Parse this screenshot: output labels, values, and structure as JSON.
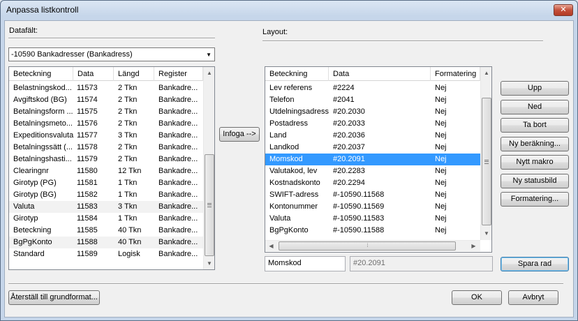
{
  "window": {
    "title": "Anpassa listkontroll",
    "close_glyph": "✕"
  },
  "left": {
    "section_label": "Datafält:",
    "combo_value": "-10590 Bankadresser (Bankadress)",
    "columns": [
      "Beteckning",
      "Data",
      "Längd",
      "Register"
    ],
    "rows": [
      [
        "Belastningskod...",
        "11573",
        "2 Tkn",
        "Bankadre..."
      ],
      [
        "Avgiftskod (BG)",
        "11574",
        "2 Tkn",
        "Bankadre..."
      ],
      [
        "Betalningsform ...",
        "11575",
        "2 Tkn",
        "Bankadre..."
      ],
      [
        "Betalningsmeto...",
        "11576",
        "2 Tkn",
        "Bankadre..."
      ],
      [
        "Expeditionsvaluta",
        "11577",
        "3 Tkn",
        "Bankadre..."
      ],
      [
        "Betalningssätt (...",
        "11578",
        "2 Tkn",
        "Bankadre..."
      ],
      [
        "Betalningshasti...",
        "11579",
        "2 Tkn",
        "Bankadre..."
      ],
      [
        "Clearingnr",
        "11580",
        "12 Tkn",
        "Bankadre..."
      ],
      [
        "Girotyp (PG)",
        "11581",
        "1 Tkn",
        "Bankadre..."
      ],
      [
        "Girotyp (BG)",
        "11582",
        "1 Tkn",
        "Bankadre..."
      ],
      [
        "Valuta",
        "11583",
        "3 Tkn",
        "Bankadre..."
      ],
      [
        "Girotyp",
        "11584",
        "1 Tkn",
        "Bankadre..."
      ],
      [
        "Beteckning",
        "11585",
        "40 Tkn",
        "Bankadre..."
      ],
      [
        "BgPgKonto",
        "11588",
        "40 Tkn",
        "Bankadre..."
      ],
      [
        "Standard",
        "11589",
        "Logisk",
        "Bankadre..."
      ]
    ],
    "highlighted_rows": [
      10,
      13
    ]
  },
  "insert_button": "Infoga -->",
  "right": {
    "section_label": "Layout:",
    "columns": [
      "Beteckning",
      "Data",
      "Formatering"
    ],
    "rows": [
      [
        "Lev referens",
        "#2224",
        "Nej"
      ],
      [
        "Telefon",
        "#2041",
        "Nej"
      ],
      [
        "Utdelningsadress",
        "#20.2030",
        "Nej"
      ],
      [
        "Postadress",
        "#20.2033",
        "Nej"
      ],
      [
        "Land",
        "#20.2036",
        "Nej"
      ],
      [
        "Landkod",
        "#20.2037",
        "Nej"
      ],
      [
        "Momskod",
        "#20.2091",
        "Nej"
      ],
      [
        "Valutakod, lev",
        "#20.2283",
        "Nej"
      ],
      [
        "Kostnadskonto",
        "#20.2294",
        "Nej"
      ],
      [
        "SWIFT-adress",
        "#-10590.11568",
        "Nej"
      ],
      [
        "Kontonummer",
        "#-10590.11569",
        "Nej"
      ],
      [
        "Valuta",
        "#-10590.11583",
        "Nej"
      ],
      [
        "BgPgKonto",
        "#-10590.11588",
        "Nej"
      ]
    ],
    "selected_row": 6,
    "edit_name": "Momskod",
    "edit_data": "#20.2091"
  },
  "side_buttons": [
    "Upp",
    "Ned",
    "Ta bort",
    "Ny beräkning...",
    "Nytt makro",
    "Ny statusbild",
    "Formatering..."
  ],
  "save_row_button": "Spara rad",
  "reset_button": "Återställ till grundformat...",
  "ok_button": "OK",
  "cancel_button": "Avbryt",
  "icons": {
    "scroll_up": "▲",
    "scroll_down": "▼",
    "scroll_left": "◀",
    "scroll_right": "▶",
    "combo_arrow": "▼",
    "grip": "⁞"
  },
  "colors": {
    "selection": "#3399ff",
    "accent_close": "#c4503b"
  }
}
